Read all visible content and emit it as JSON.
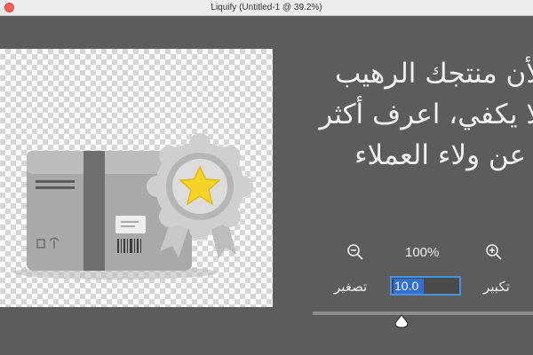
{
  "window": {
    "title": "Liquify (Untitled-1 @ 39.2%)"
  },
  "canvas": {
    "content": "box-with-award-ribbon",
    "ribbon_accent_color": "#f5d327"
  },
  "headline": {
    "lines": [
      "لأن منتجك الرهيب",
      "لا يكفي، اعرف أكثر",
      "عن ولاء العملاء"
    ]
  },
  "zoom": {
    "value": "100%",
    "zoom_out_icon": "magnifier-minus-icon",
    "zoom_in_icon": "magnifier-plus-icon"
  },
  "brush": {
    "size_value": "10.0",
    "shrink_label": "تصغير",
    "enlarge_label": "تكبير",
    "slider_level": 0.39
  }
}
